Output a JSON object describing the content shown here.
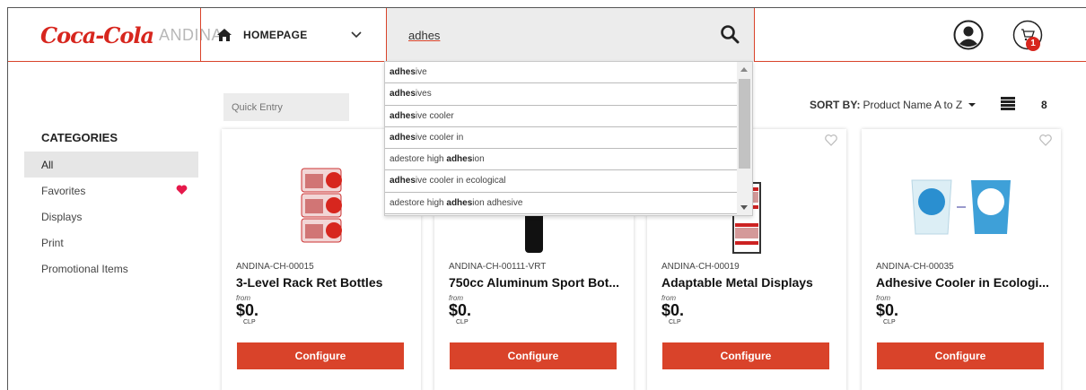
{
  "header": {
    "logo_brand": "Coca-Cola",
    "logo_company": "ANDINA",
    "nav_label": "HOMEPAGE",
    "search_value": "adhes",
    "cart_count": "1"
  },
  "sidebar": {
    "title": "CATEGORIES",
    "items": [
      {
        "label": "All"
      },
      {
        "label": "Favorites"
      },
      {
        "label": "Displays"
      },
      {
        "label": "Print"
      },
      {
        "label": "Promotional Items"
      }
    ]
  },
  "toolbar": {
    "quick_entry_placeholder": "Quick Entry",
    "sort_label": "SORT BY:",
    "sort_value": "Product Name A to Z",
    "count": "8"
  },
  "suggestions": [
    {
      "match": "adhes",
      "rest": "ive"
    },
    {
      "match": "adhes",
      "rest": "ives"
    },
    {
      "match": "adhes",
      "rest": "ive cooler"
    },
    {
      "match": "adhes",
      "rest": "ive cooler in"
    },
    {
      "pre": "adestore high ",
      "match": "adhes",
      "rest": "ion"
    },
    {
      "match": "adhes",
      "rest": "ive cooler in ecological"
    },
    {
      "pre": "adestore high ",
      "match": "adhes",
      "rest": "ion adhesive"
    }
  ],
  "products": [
    {
      "sku": "ANDINA-CH-00015",
      "name": "3-Level Rack Ret Bottles",
      "from": "from",
      "price": "$0.",
      "currency": "CLP",
      "cta": "Configure"
    },
    {
      "sku": "ANDINA-CH-00111-VRT",
      "name": "750cc Aluminum Sport Bot...",
      "from": "from",
      "price": "$0.",
      "currency": "CLP",
      "cta": "Configure"
    },
    {
      "sku": "ANDINA-CH-00019",
      "name": "Adaptable Metal Displays",
      "from": "from",
      "price": "$0.",
      "currency": "CLP",
      "cta": "Configure"
    },
    {
      "sku": "ANDINA-CH-00035",
      "name": "Adhesive Cooler in Ecologi...",
      "from": "from",
      "price": "$0.",
      "currency": "CLP",
      "cta": "Configure"
    }
  ],
  "colors": {
    "accent": "#d9432a",
    "brand_red": "#d7261e",
    "favorite": "#e6194b"
  },
  "icons": [
    "home-icon",
    "chevron-down-icon",
    "search-icon",
    "user-icon",
    "cart-icon",
    "heart-icon",
    "heart-outline-icon",
    "list-view-icon",
    "caret-down-icon"
  ]
}
